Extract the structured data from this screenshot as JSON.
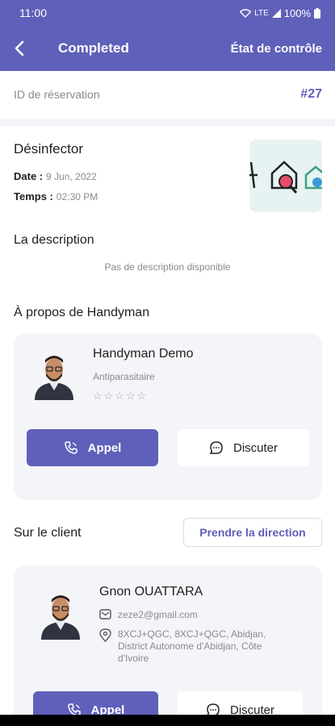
{
  "status": {
    "time": "11:00",
    "network": "LTE",
    "battery": "100%"
  },
  "header": {
    "title": "Completed",
    "action": "État de contrôle"
  },
  "booking": {
    "id_label": "ID de réservation",
    "id_value": "#27"
  },
  "service": {
    "name": "Désinfector",
    "date_label": "Date :",
    "date_value": "9 Jun, 2022",
    "time_label": "Temps :",
    "time_value": "02:30 PM"
  },
  "description": {
    "title": "La description",
    "empty": "Pas de description disponible"
  },
  "handyman": {
    "section_title": "À propos de Handyman",
    "name": "Handyman Demo",
    "role": "Antiparasitaire",
    "stars": "☆☆☆☆☆",
    "call_label": "Appel",
    "chat_label": "Discuter"
  },
  "client": {
    "section_title": "Sur le client",
    "direction_label": "Prendre la direction",
    "name": "Gnon OUATTARA",
    "email": "zeze2@gmail.com",
    "address": "8XCJ+QGC, 8XCJ+QGC, Abidjan, District Autonome d'Abidjan, Côte d'Ivoire",
    "call_label": "Appel",
    "chat_label": "Discuter"
  },
  "colors": {
    "primary": "#5f60b9",
    "card_bg": "#f4f5f8",
    "muted_text": "#8a8a8e"
  }
}
